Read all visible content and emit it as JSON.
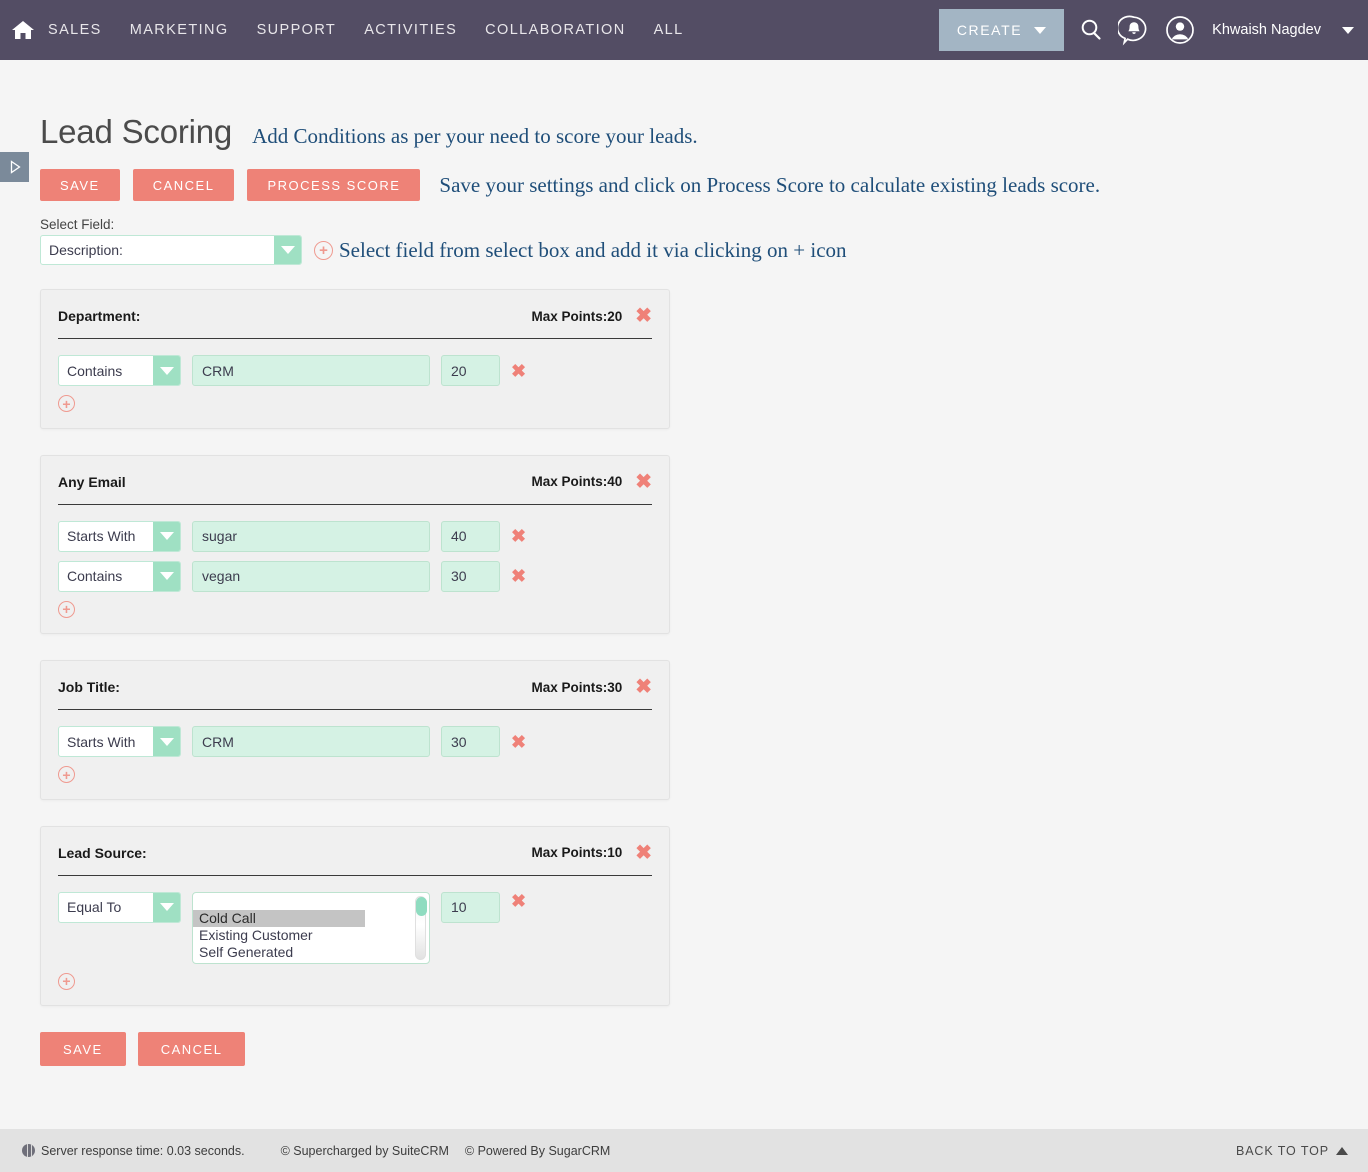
{
  "topnav": {
    "home_icon": "home-icon",
    "items": [
      "SALES",
      "MARKETING",
      "SUPPORT",
      "ACTIVITIES",
      "COLLABORATION",
      "ALL"
    ],
    "create_label": "CREATE",
    "search_icon": "search-icon",
    "notification_icon": "notification-bell-icon",
    "avatar_icon": "user-avatar-icon",
    "user_name": "Khwaish Nagdev",
    "bg_color": "#534d64",
    "create_bg": "#a3b5c4"
  },
  "page": {
    "title": "Lead Scoring",
    "title_hint": "Add Conditions as per your need to score your leads.",
    "action_hint": "Save your settings and click on Process Score to calculate existing leads score.",
    "save_label": "SAVE",
    "cancel_label": "CANCEL",
    "process_label": "PROCESS SCORE",
    "accent_coral": "#ee8277",
    "accent_mint": "#9fe0c3",
    "hint_color": "#1f4e79"
  },
  "select_field": {
    "label": "Select Field:",
    "value": "Description:",
    "add_hint": "Select field from select box and add it via clicking on + icon"
  },
  "cards": [
    {
      "title": "Department:",
      "max_points": "Max Points:20",
      "rows": [
        {
          "operator": "Contains",
          "value": "CRM",
          "points": "20",
          "type": "text"
        }
      ]
    },
    {
      "title": "Any Email",
      "max_points": "Max Points:40",
      "rows": [
        {
          "operator": "Starts With",
          "value": "sugar",
          "points": "40",
          "type": "text"
        },
        {
          "operator": "Contains",
          "value": "vegan",
          "points": "30",
          "type": "text"
        }
      ]
    },
    {
      "title": "Job Title:",
      "max_points": "Max Points:30",
      "rows": [
        {
          "operator": "Starts With",
          "value": "CRM",
          "points": "30",
          "type": "text"
        }
      ]
    },
    {
      "title": "Lead Source:",
      "max_points": "Max Points:10",
      "rows": [
        {
          "operator": "Equal To",
          "points": "10",
          "type": "listbox",
          "options": [
            "",
            "Cold Call",
            "Existing Customer",
            "Self Generated"
          ],
          "selected": "Cold Call"
        }
      ]
    }
  ],
  "bottom": {
    "save_label": "SAVE",
    "cancel_label": "CANCEL"
  },
  "footer": {
    "server_time": "Server response time: 0.03 seconds.",
    "credit_1": "© Supercharged by SuiteCRM",
    "credit_2": "© Powered By SugarCRM",
    "back_to_top": "BACK TO TOP"
  }
}
